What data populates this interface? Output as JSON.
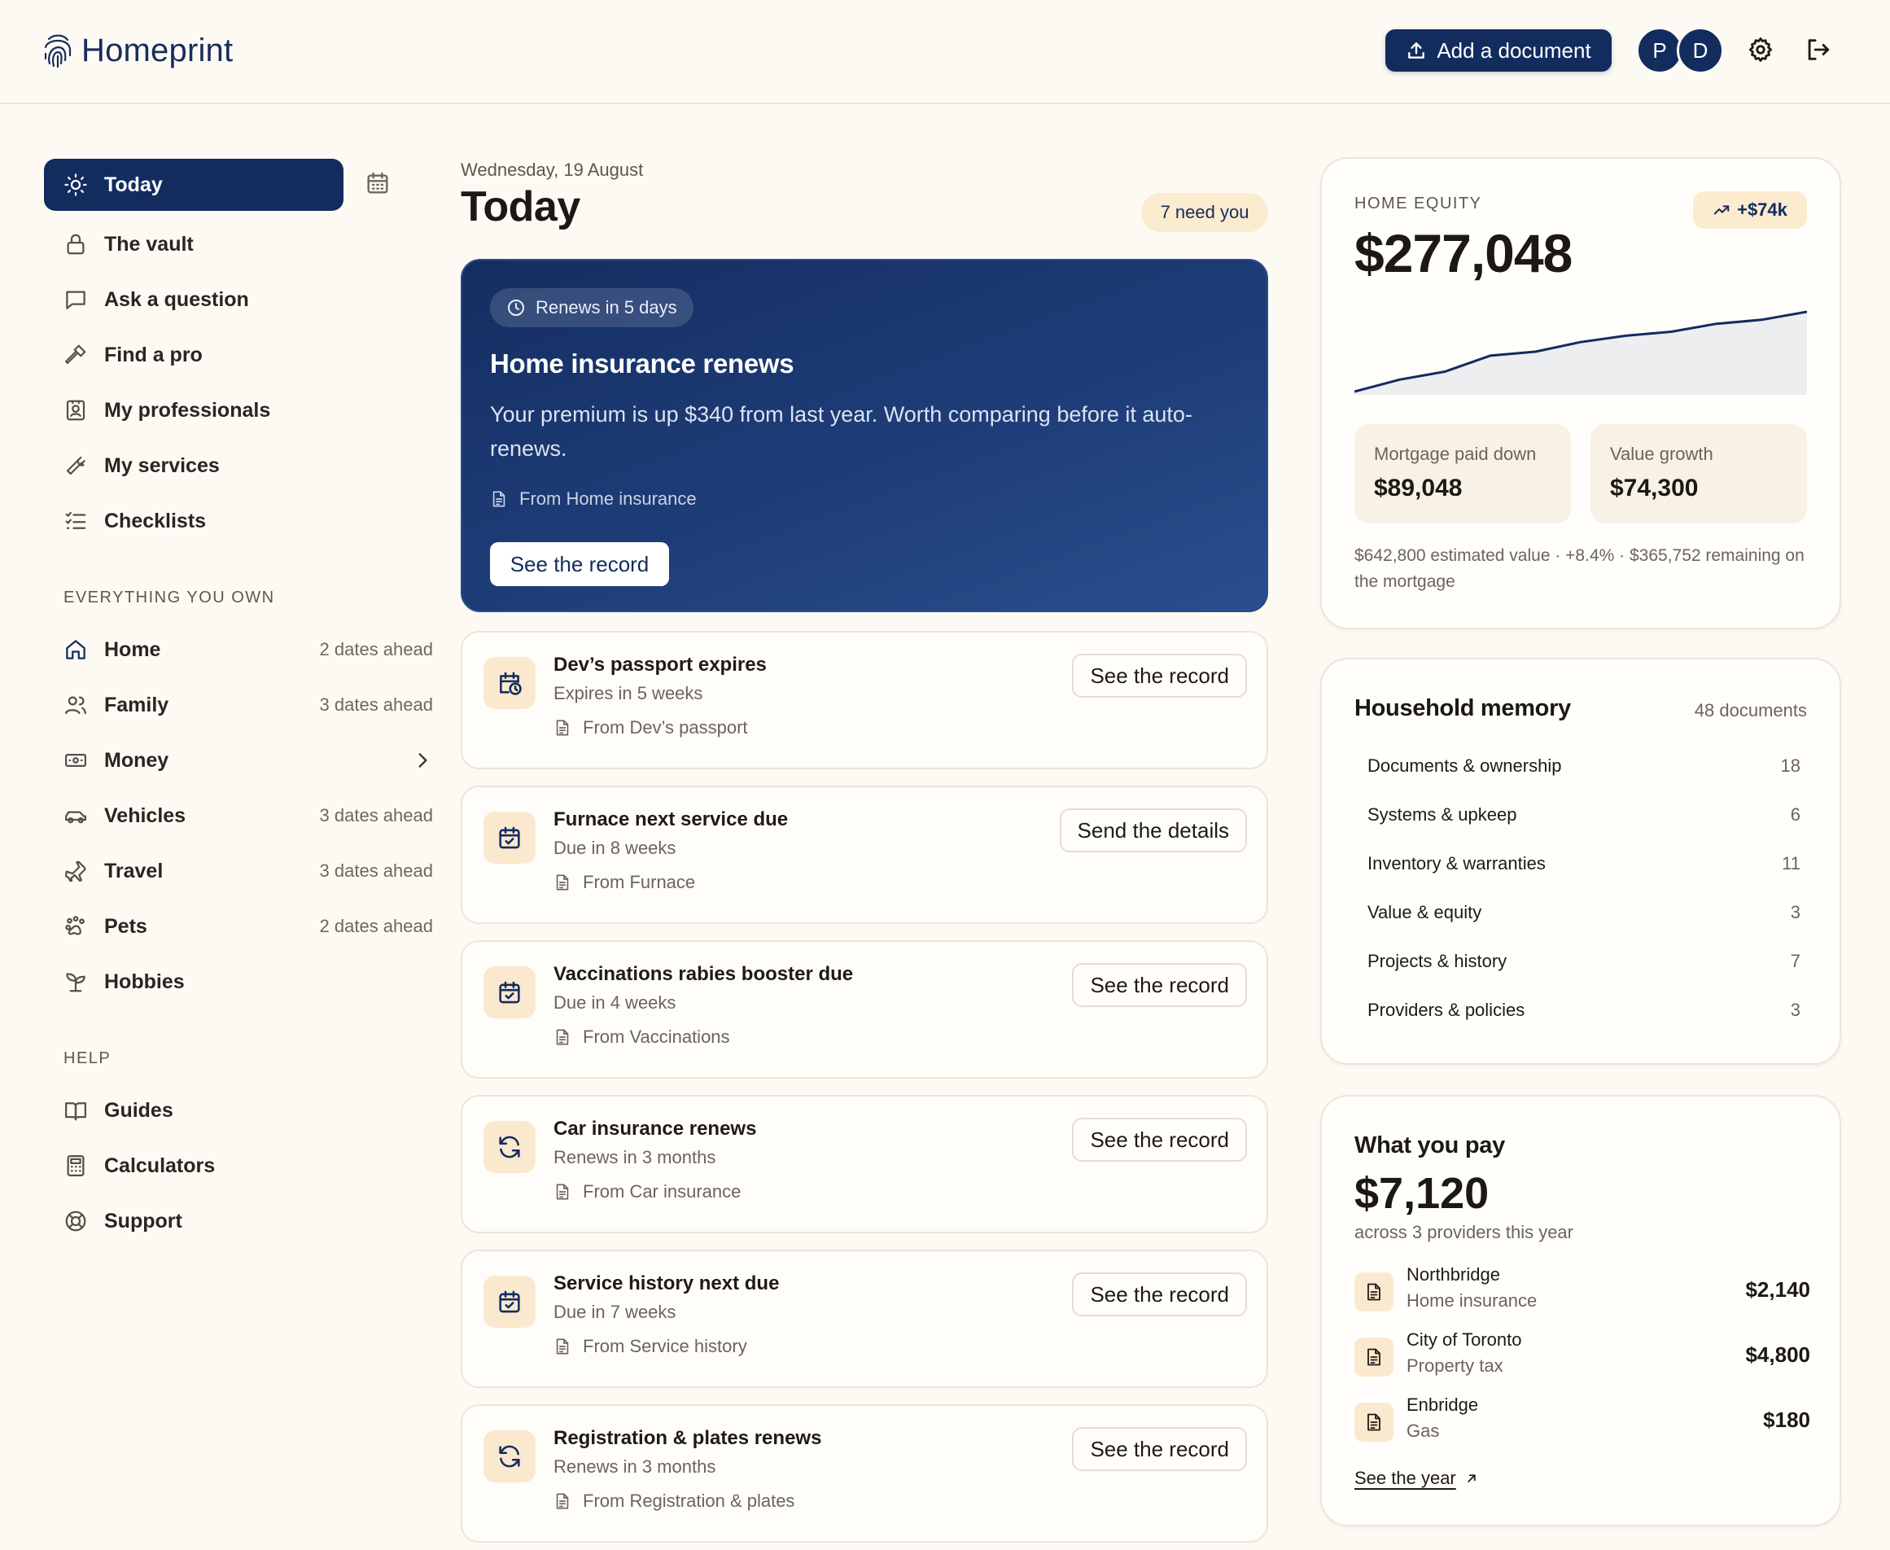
{
  "app": {
    "name": "Homeprint"
  },
  "header": {
    "add_document": "Add a document",
    "avatars": [
      "P",
      "D"
    ],
    "icons": [
      "upload-icon",
      "gear-icon",
      "logout-icon"
    ]
  },
  "sidebar": {
    "nav": [
      {
        "label": "Today",
        "icon": "sun-icon",
        "active": true
      },
      {
        "label": "The vault",
        "icon": "lock-icon"
      },
      {
        "label": "Ask a question",
        "icon": "chat-icon"
      },
      {
        "label": "Find a pro",
        "icon": "hammer-icon"
      },
      {
        "label": "My professionals",
        "icon": "contact-icon"
      },
      {
        "label": "My services",
        "icon": "wrench-icon"
      },
      {
        "label": "Checklists",
        "icon": "checklist-icon"
      }
    ],
    "own_section": "EVERYTHING YOU OWN",
    "own": [
      {
        "label": "Home",
        "aux": "2 dates ahead",
        "icon": "home-icon"
      },
      {
        "label": "Family",
        "aux": "3 dates ahead",
        "icon": "people-icon"
      },
      {
        "label": "Money",
        "aux": "",
        "icon": "banknote-icon"
      },
      {
        "label": "Vehicles",
        "aux": "3 dates ahead",
        "icon": "car-icon"
      },
      {
        "label": "Travel",
        "aux": "3 dates ahead",
        "icon": "plane-icon"
      },
      {
        "label": "Pets",
        "aux": "2 dates ahead",
        "icon": "paw-icon"
      },
      {
        "label": "Hobbies",
        "aux": "",
        "icon": "sprout-icon"
      }
    ],
    "help_section": "HELP",
    "help": [
      {
        "label": "Guides",
        "icon": "book-icon"
      },
      {
        "label": "Calculators",
        "icon": "calculator-icon"
      },
      {
        "label": "Support",
        "icon": "lifebuoy-icon"
      }
    ]
  },
  "main": {
    "date": "Wednesday, 19 August",
    "title": "Today",
    "need_pill": "7 need you",
    "hero": {
      "chip": "Renews in 5 days",
      "title": "Home insurance renews",
      "body": "Your premium is up $340 from last year. Worth comparing before it auto-renews.",
      "source": "From Home insurance",
      "button": "See the record"
    },
    "tasks": [
      {
        "title": "Dev’s passport expires",
        "sub": "Expires in 5 weeks",
        "source": "From Dev’s passport",
        "button": "See the record",
        "icon": "calendar-clock-icon"
      },
      {
        "title": "Furnace next service due",
        "sub": "Due in 8 weeks",
        "source": "From Furnace",
        "button": "Send the details",
        "icon": "calendar-check-icon"
      },
      {
        "title": "Vaccinations rabies booster due",
        "sub": "Due in 4 weeks",
        "source": "From Vaccinations",
        "button": "See the record",
        "icon": "calendar-check-icon"
      },
      {
        "title": "Car insurance renews",
        "sub": "Renews in 3 months",
        "source": "From Car insurance",
        "button": "See the record",
        "icon": "refresh-icon"
      },
      {
        "title": "Service history next due",
        "sub": "Due in 7 weeks",
        "source": "From Service history",
        "button": "See the record",
        "icon": "calendar-check-icon"
      },
      {
        "title": "Registration & plates renews",
        "sub": "Renews in 3 months",
        "source": "From Registration & plates",
        "button": "See the record",
        "icon": "refresh-icon"
      }
    ]
  },
  "equity": {
    "label": "HOME EQUITY",
    "value": "$277,048",
    "change": "+$74k",
    "tiles": [
      {
        "label": "Mortgage paid down",
        "value": "$89,048"
      },
      {
        "label": "Value growth",
        "value": "$74,300"
      }
    ],
    "note": "$642,800 estimated value · +8.4% · $365,752 remaining on the mortgage",
    "chart_data": {
      "type": "area",
      "values": [
        0.0,
        0.15,
        0.25,
        0.45,
        0.5,
        0.62,
        0.7,
        0.75,
        0.85,
        0.9,
        1.0
      ],
      "color": "#132c5e",
      "fill": "#eceef0"
    }
  },
  "memory": {
    "title": "Household memory",
    "count": "48 documents",
    "rows": [
      {
        "label": "Documents & ownership",
        "n": "18"
      },
      {
        "label": "Systems & upkeep",
        "n": "6"
      },
      {
        "label": "Inventory & warranties",
        "n": "11"
      },
      {
        "label": "Value & equity",
        "n": "3"
      },
      {
        "label": "Projects & history",
        "n": "7"
      },
      {
        "label": "Providers & policies",
        "n": "3"
      }
    ]
  },
  "pay": {
    "title": "What you pay",
    "total": "$7,120",
    "sub": "across 3 providers this year",
    "rows": [
      {
        "name": "Northbridge",
        "kind": "Home insurance",
        "amount": "$2,140"
      },
      {
        "name": "City of Toronto",
        "kind": "Property tax",
        "amount": "$4,800"
      },
      {
        "name": "Enbridge",
        "kind": "Gas",
        "amount": "$180"
      }
    ],
    "link": "See the year"
  },
  "colors": {
    "navy": "#132c5e",
    "cream": "#fdfaf4",
    "peach": "#fbebcf"
  }
}
